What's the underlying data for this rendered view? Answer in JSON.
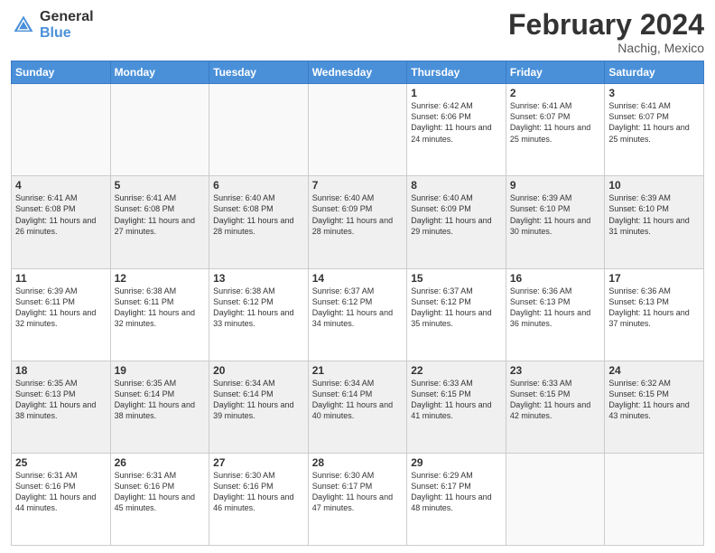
{
  "logo": {
    "general": "General",
    "blue": "Blue"
  },
  "header": {
    "month": "February 2024",
    "location": "Nachig, Mexico"
  },
  "weekdays": [
    "Sunday",
    "Monday",
    "Tuesday",
    "Wednesday",
    "Thursday",
    "Friday",
    "Saturday"
  ],
  "weeks": [
    [
      {
        "day": "",
        "info": ""
      },
      {
        "day": "",
        "info": ""
      },
      {
        "day": "",
        "info": ""
      },
      {
        "day": "",
        "info": ""
      },
      {
        "day": "1",
        "info": "Sunrise: 6:42 AM\nSunset: 6:06 PM\nDaylight: 11 hours and 24 minutes."
      },
      {
        "day": "2",
        "info": "Sunrise: 6:41 AM\nSunset: 6:07 PM\nDaylight: 11 hours and 25 minutes."
      },
      {
        "day": "3",
        "info": "Sunrise: 6:41 AM\nSunset: 6:07 PM\nDaylight: 11 hours and 25 minutes."
      }
    ],
    [
      {
        "day": "4",
        "info": "Sunrise: 6:41 AM\nSunset: 6:08 PM\nDaylight: 11 hours and 26 minutes."
      },
      {
        "day": "5",
        "info": "Sunrise: 6:41 AM\nSunset: 6:08 PM\nDaylight: 11 hours and 27 minutes."
      },
      {
        "day": "6",
        "info": "Sunrise: 6:40 AM\nSunset: 6:08 PM\nDaylight: 11 hours and 28 minutes."
      },
      {
        "day": "7",
        "info": "Sunrise: 6:40 AM\nSunset: 6:09 PM\nDaylight: 11 hours and 28 minutes."
      },
      {
        "day": "8",
        "info": "Sunrise: 6:40 AM\nSunset: 6:09 PM\nDaylight: 11 hours and 29 minutes."
      },
      {
        "day": "9",
        "info": "Sunrise: 6:39 AM\nSunset: 6:10 PM\nDaylight: 11 hours and 30 minutes."
      },
      {
        "day": "10",
        "info": "Sunrise: 6:39 AM\nSunset: 6:10 PM\nDaylight: 11 hours and 31 minutes."
      }
    ],
    [
      {
        "day": "11",
        "info": "Sunrise: 6:39 AM\nSunset: 6:11 PM\nDaylight: 11 hours and 32 minutes."
      },
      {
        "day": "12",
        "info": "Sunrise: 6:38 AM\nSunset: 6:11 PM\nDaylight: 11 hours and 32 minutes."
      },
      {
        "day": "13",
        "info": "Sunrise: 6:38 AM\nSunset: 6:12 PM\nDaylight: 11 hours and 33 minutes."
      },
      {
        "day": "14",
        "info": "Sunrise: 6:37 AM\nSunset: 6:12 PM\nDaylight: 11 hours and 34 minutes."
      },
      {
        "day": "15",
        "info": "Sunrise: 6:37 AM\nSunset: 6:12 PM\nDaylight: 11 hours and 35 minutes."
      },
      {
        "day": "16",
        "info": "Sunrise: 6:36 AM\nSunset: 6:13 PM\nDaylight: 11 hours and 36 minutes."
      },
      {
        "day": "17",
        "info": "Sunrise: 6:36 AM\nSunset: 6:13 PM\nDaylight: 11 hours and 37 minutes."
      }
    ],
    [
      {
        "day": "18",
        "info": "Sunrise: 6:35 AM\nSunset: 6:13 PM\nDaylight: 11 hours and 38 minutes."
      },
      {
        "day": "19",
        "info": "Sunrise: 6:35 AM\nSunset: 6:14 PM\nDaylight: 11 hours and 38 minutes."
      },
      {
        "day": "20",
        "info": "Sunrise: 6:34 AM\nSunset: 6:14 PM\nDaylight: 11 hours and 39 minutes."
      },
      {
        "day": "21",
        "info": "Sunrise: 6:34 AM\nSunset: 6:14 PM\nDaylight: 11 hours and 40 minutes."
      },
      {
        "day": "22",
        "info": "Sunrise: 6:33 AM\nSunset: 6:15 PM\nDaylight: 11 hours and 41 minutes."
      },
      {
        "day": "23",
        "info": "Sunrise: 6:33 AM\nSunset: 6:15 PM\nDaylight: 11 hours and 42 minutes."
      },
      {
        "day": "24",
        "info": "Sunrise: 6:32 AM\nSunset: 6:15 PM\nDaylight: 11 hours and 43 minutes."
      }
    ],
    [
      {
        "day": "25",
        "info": "Sunrise: 6:31 AM\nSunset: 6:16 PM\nDaylight: 11 hours and 44 minutes."
      },
      {
        "day": "26",
        "info": "Sunrise: 6:31 AM\nSunset: 6:16 PM\nDaylight: 11 hours and 45 minutes."
      },
      {
        "day": "27",
        "info": "Sunrise: 6:30 AM\nSunset: 6:16 PM\nDaylight: 11 hours and 46 minutes."
      },
      {
        "day": "28",
        "info": "Sunrise: 6:30 AM\nSunset: 6:17 PM\nDaylight: 11 hours and 47 minutes."
      },
      {
        "day": "29",
        "info": "Sunrise: 6:29 AM\nSunset: 6:17 PM\nDaylight: 11 hours and 48 minutes."
      },
      {
        "day": "",
        "info": ""
      },
      {
        "day": "",
        "info": ""
      }
    ]
  ]
}
